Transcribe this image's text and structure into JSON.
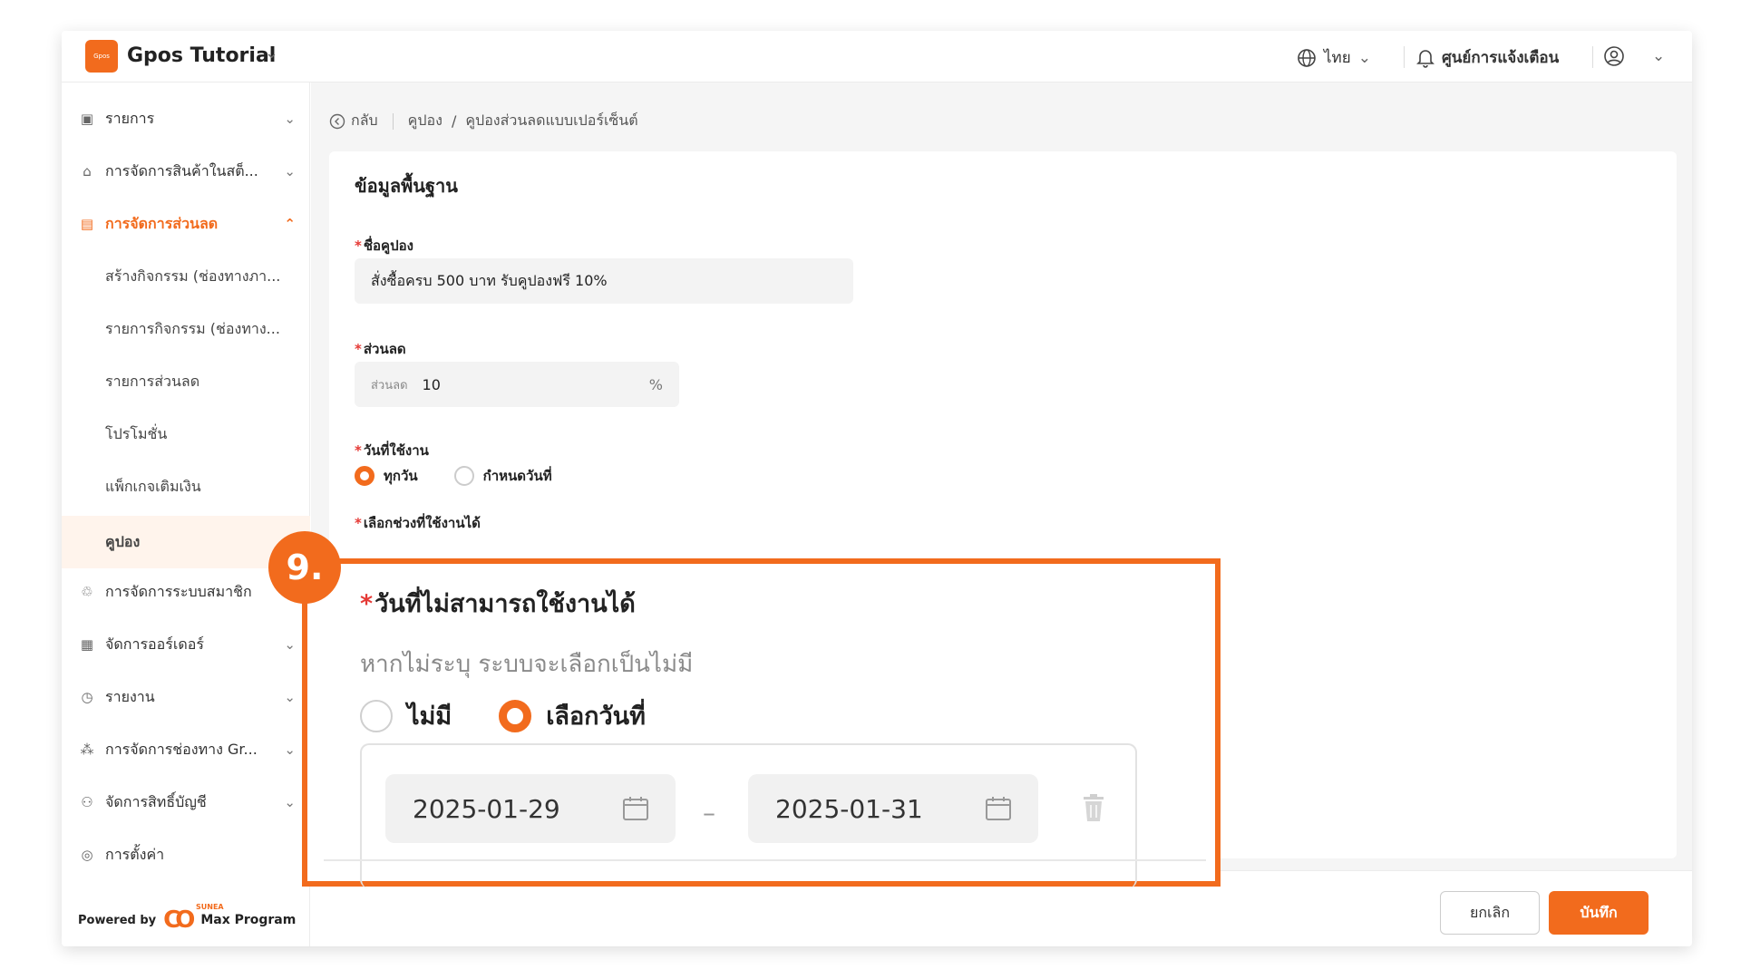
{
  "topbar": {
    "logo_text": "Gpos",
    "app_title": "Gpos Tutorial",
    "language": "ไทย",
    "notifications_label": "ศูนย์การแจ้งเตือน"
  },
  "sidebar": {
    "items": [
      {
        "label": "รายการ",
        "icon": "box-icon"
      },
      {
        "label": "การจัดการสินค้าในสต็...",
        "icon": "warehouse-icon"
      },
      {
        "label": "การจัดการส่วนลด",
        "icon": "discount-icon"
      },
      {
        "label": "สร้างกิจกรรม (ช่องทางภา..."
      },
      {
        "label": "รายการกิจกรรม (ช่องทาง..."
      },
      {
        "label": "รายการส่วนลด"
      },
      {
        "label": "โปรโมชั่น"
      },
      {
        "label": "แพ็กเกจเติมเงิน"
      },
      {
        "label": "คูปอง"
      },
      {
        "label": "การจัดการระบบสมาชิก",
        "icon": "member-icon"
      },
      {
        "label": "จัดการออร์เดอร์",
        "icon": "order-icon"
      },
      {
        "label": "รายงาน",
        "icon": "report-icon"
      },
      {
        "label": "การจัดการช่องทาง Gr...",
        "icon": "channel-icon"
      },
      {
        "label": "จัดการสิทธิ์บัญชี",
        "icon": "account-icon"
      },
      {
        "label": "การตั้งค่า",
        "icon": "settings-icon"
      }
    ],
    "powered_by": "Powered by",
    "brand_name": "Max Program",
    "brand_sub": "SUNEA"
  },
  "breadcrumb": {
    "back": "กลับ",
    "level1": "คูปอง",
    "sep": "/",
    "level2": "คูปองส่วนลดแบบเปอร์เซ็นต์"
  },
  "form": {
    "section_title": "ข้อมูลพื้นฐาน",
    "coupon_name_label": "ชื่อคูปอง",
    "coupon_name_value": "สั่งซื้อครบ 500 บาท รับคูปองฟรี 10%",
    "discount_label": "ส่วนลด",
    "discount_prefix": "ส่วนลด",
    "discount_value": "10",
    "discount_unit": "%",
    "usage_day_label": "วันที่ใช้งาน",
    "usage_opt_everyday": "ทุกวัน",
    "usage_opt_specific": "กำหนดวันที่",
    "usage_period_label": "เลือกช่วงที่ใช้งานได้",
    "required_mark": "*"
  },
  "highlight": {
    "step": "9.",
    "title": "วันที่ไม่สามารถใช้งานได้",
    "hint": "หากไม่ระบุ ระบบจะเลือกเป็นไม่มี",
    "opt_none": "ไม่มี",
    "opt_select": "เลือกวันที่",
    "start_date": "2025-01-29",
    "end_date": "2025-01-31",
    "range_dash": "–"
  },
  "footer": {
    "cancel": "ยกเลิก",
    "save": "บันทึก"
  },
  "colors": {
    "accent": "#f26b1d",
    "required": "#e53935"
  }
}
